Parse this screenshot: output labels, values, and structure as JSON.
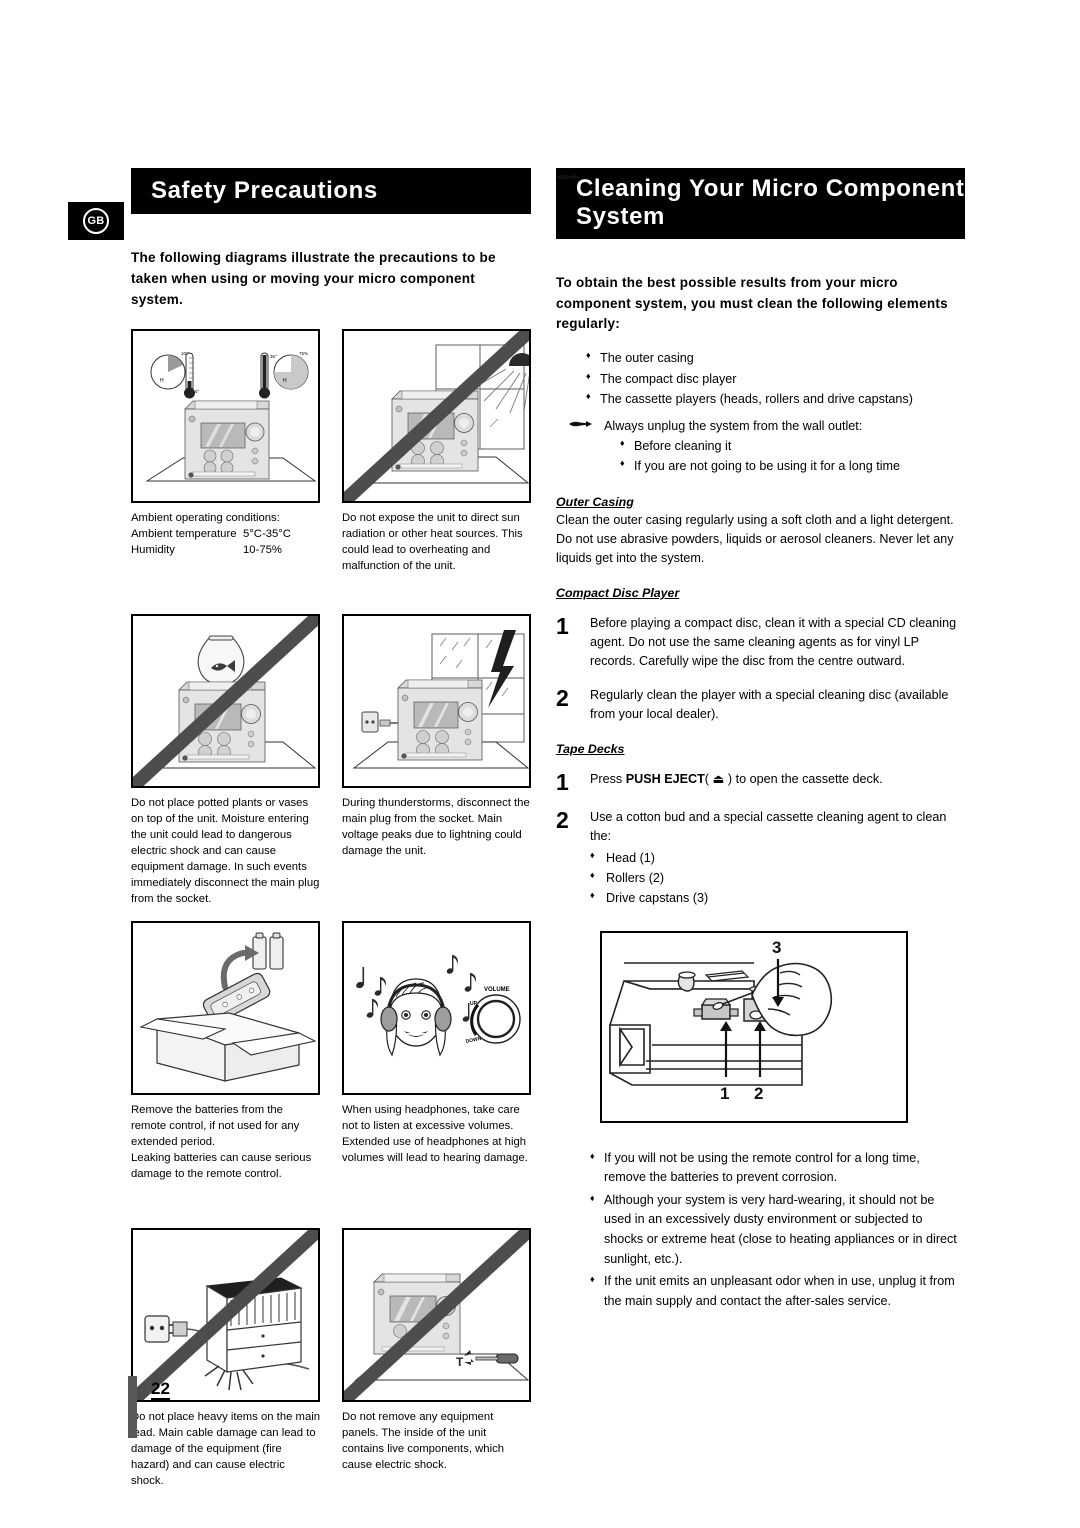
{
  "locale_badge": "GB",
  "page_number": "22",
  "left": {
    "header": "Safety Precautions",
    "intro": "The following diagrams illustrate the precautions to be taken when using or moving your micro component system.",
    "panels": [
      {
        "id": "ambient-conditions",
        "caption_lines": [
          "Ambient operating conditions:"
        ],
        "rows": [
          {
            "key": "Ambient temperature",
            "value": "5°C-35°C"
          },
          {
            "key": "Humidity",
            "value": "10-75%"
          }
        ],
        "prohibited": false,
        "art": "micro-system-with-thermometers-and-humidity-gauges"
      },
      {
        "id": "direct-sunlight",
        "caption": "Do not expose the unit to direct sun radiation or other heat sources. This could lead to overheating and malfunction of the unit.",
        "prohibited": true,
        "art": "micro-system-by-sunny-window"
      },
      {
        "id": "potted-plants",
        "caption": "Do not place potted plants or vases on top of the unit. Moisture entering the unit could lead to dangerous electric shock and can cause equipment damage. In such events immediately disconnect the main plug from the socket.",
        "prohibited": true,
        "art": "fishbowl-on-top-of-micro-system"
      },
      {
        "id": "thunderstorms",
        "caption": "During thunderstorms, disconnect the main plug from the socket. Main voltage peaks due to lightning could damage the unit.",
        "prohibited": false,
        "art": "micro-system-unplugged-during-lightning-storm"
      },
      {
        "id": "remote-batteries",
        "caption": "Remove the batteries from the remote control, if not used for any extended period.\nLeaking batteries can cause serious damage to the remote control.",
        "prohibited": false,
        "art": "remote-control-batteries-in-storage-box"
      },
      {
        "id": "headphone-volume",
        "caption": "When using headphones, take care not to listen at excessive volumes. Extended use of headphones at high volumes will lead to hearing damage.",
        "prohibited": false,
        "art": "girl-wearing-headphones-with-volume-knob",
        "labels": {
          "volume": "VOLUME",
          "up": "UP",
          "down": "DOWN"
        }
      },
      {
        "id": "heavy-items-on-lead",
        "caption": "Do not place heavy items on the main lead. Main cable damage can lead to damage of the equipment (fire hazard) and can cause electric shock.",
        "prohibited": true,
        "art": "furniture-crushing-mains-cable-at-wall-socket"
      },
      {
        "id": "remove-panels",
        "caption": "Do not remove any equipment panels. The inside of the unit\ncontains live components, which cause electric shock.",
        "prohibited": true,
        "art": "screwdriver-opening-micro-system-panel"
      }
    ]
  },
  "right": {
    "header": "Cleaning Your Micro Component System",
    "intro": "To obtain the best possible results from your micro component system, you must clean the following elements regularly:",
    "clean_items": [
      "The outer casing",
      "The compact disc player",
      "The cassette players (heads, rollers and drive capstans)"
    ],
    "unplug_note": "Always unplug the system from the wall outlet:",
    "unplug_items": [
      "Before cleaning it",
      "If you are not going to be using it for a long time"
    ],
    "outer_casing": {
      "title": "Outer Casing",
      "body": "Clean the outer casing regularly using a soft cloth and a light detergent. Do not use abrasive powders, liquids or aerosol cleaners. Never let any liquids get into the system."
    },
    "cd_player": {
      "title": "Compact Disc Player",
      "steps": [
        {
          "num": "1",
          "text": "Before playing a compact disc, clean it with a special CD cleaning agent. Do not use the same cleaning agents as for vinyl LP records. Carefully wipe the disc from the centre outward."
        },
        {
          "num": "2",
          "text": "Regularly clean the player with a special cleaning disc (available from your local dealer)."
        }
      ]
    },
    "tape_decks": {
      "title": "Tape Decks",
      "step1": {
        "num": "1",
        "pre": "Press ",
        "bold": "PUSH EJECT",
        "post": " to open the cassette deck.",
        "symbol": "⏏"
      },
      "step2": {
        "num": "2",
        "text": "Use a cotton bud and a special cassette cleaning agent to clean the:",
        "items": [
          "Head (1)",
          "Rollers (2)",
          "Drive capstans (3)"
        ]
      },
      "diagram": {
        "art": "hand-cleaning-cassette-deck-with-cotton-bud",
        "callouts": [
          "1",
          "2",
          "3"
        ]
      }
    },
    "notes": [
      "If you will not be using the remote control for a long time, remove the batteries to prevent corrosion.",
      "Although your system is very hard-wearing, it should not be used in an excessively dusty environment or subjected to shocks or extreme heat (close to heating appliances or in direct sunlight, etc.).",
      "If the unit emits an unpleasant odor when in use, unplug it from the main supply and contact the after-sales service."
    ]
  },
  "colors": {
    "header_bg": "#000000",
    "header_text": "#ffffff",
    "page_bar": "#595959",
    "slash": "#4d4d4d"
  }
}
